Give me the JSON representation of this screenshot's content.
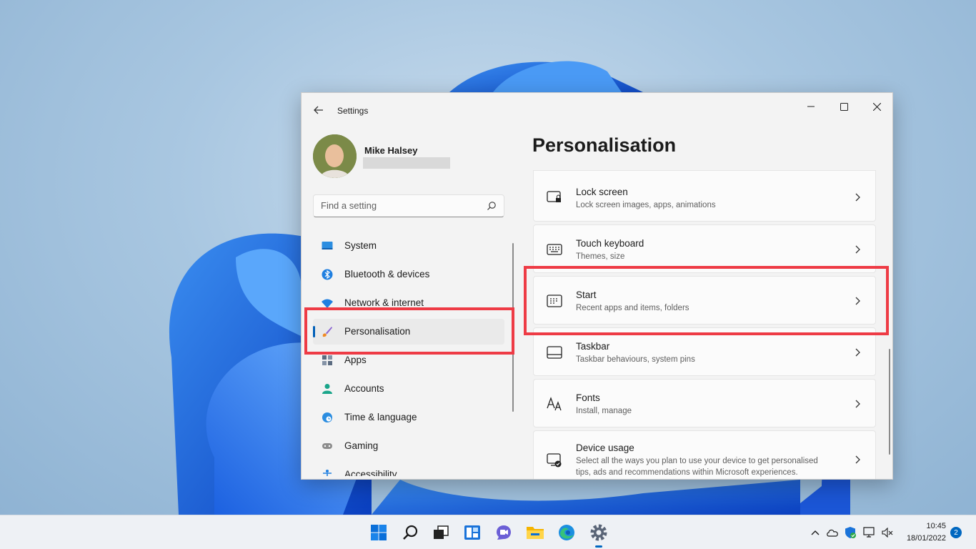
{
  "window": {
    "app_title": "Settings",
    "user": {
      "name": "Mike Halsey",
      "email": ""
    }
  },
  "search": {
    "placeholder": "Find a setting",
    "value": ""
  },
  "nav": {
    "items": [
      {
        "label": "System",
        "icon": "monitor-icon"
      },
      {
        "label": "Bluetooth & devices",
        "icon": "bluetooth-icon"
      },
      {
        "label": "Network & internet",
        "icon": "wifi-icon"
      },
      {
        "label": "Personalisation",
        "icon": "paintbrush-icon",
        "active": true
      },
      {
        "label": "Apps",
        "icon": "apps-icon"
      },
      {
        "label": "Accounts",
        "icon": "person-icon"
      },
      {
        "label": "Time & language",
        "icon": "globe-clock-icon"
      },
      {
        "label": "Gaming",
        "icon": "gamepad-icon"
      },
      {
        "label": "Accessibility",
        "icon": "accessibility-icon"
      }
    ]
  },
  "page": {
    "title": "Personalisation",
    "cards": [
      {
        "title": "Lock screen",
        "subtitle": "Lock screen images, apps, animations",
        "icon": "lock-screen-icon"
      },
      {
        "title": "Touch keyboard",
        "subtitle": "Themes, size",
        "icon": "keyboard-icon"
      },
      {
        "title": "Start",
        "subtitle": "Recent apps and items, folders",
        "icon": "start-icon"
      },
      {
        "title": "Taskbar",
        "subtitle": "Taskbar behaviours, system pins",
        "icon": "taskbar-icon"
      },
      {
        "title": "Fonts",
        "subtitle": "Install, manage",
        "icon": "fonts-icon"
      },
      {
        "title": "Device usage",
        "subtitle": "Select all the ways you plan to use your device to get personalised tips, ads and recommendations within Microsoft experiences.",
        "icon": "device-usage-icon"
      }
    ]
  },
  "taskbar": {
    "apps": [
      "start-button",
      "search",
      "task-view",
      "widgets",
      "chat",
      "file-explorer",
      "edge",
      "settings"
    ],
    "clock": {
      "time": "10:45",
      "date": "18/01/2022"
    },
    "notifications": "2"
  },
  "colors": {
    "accent": "#005fb8",
    "highlight": "#ee3b45"
  }
}
